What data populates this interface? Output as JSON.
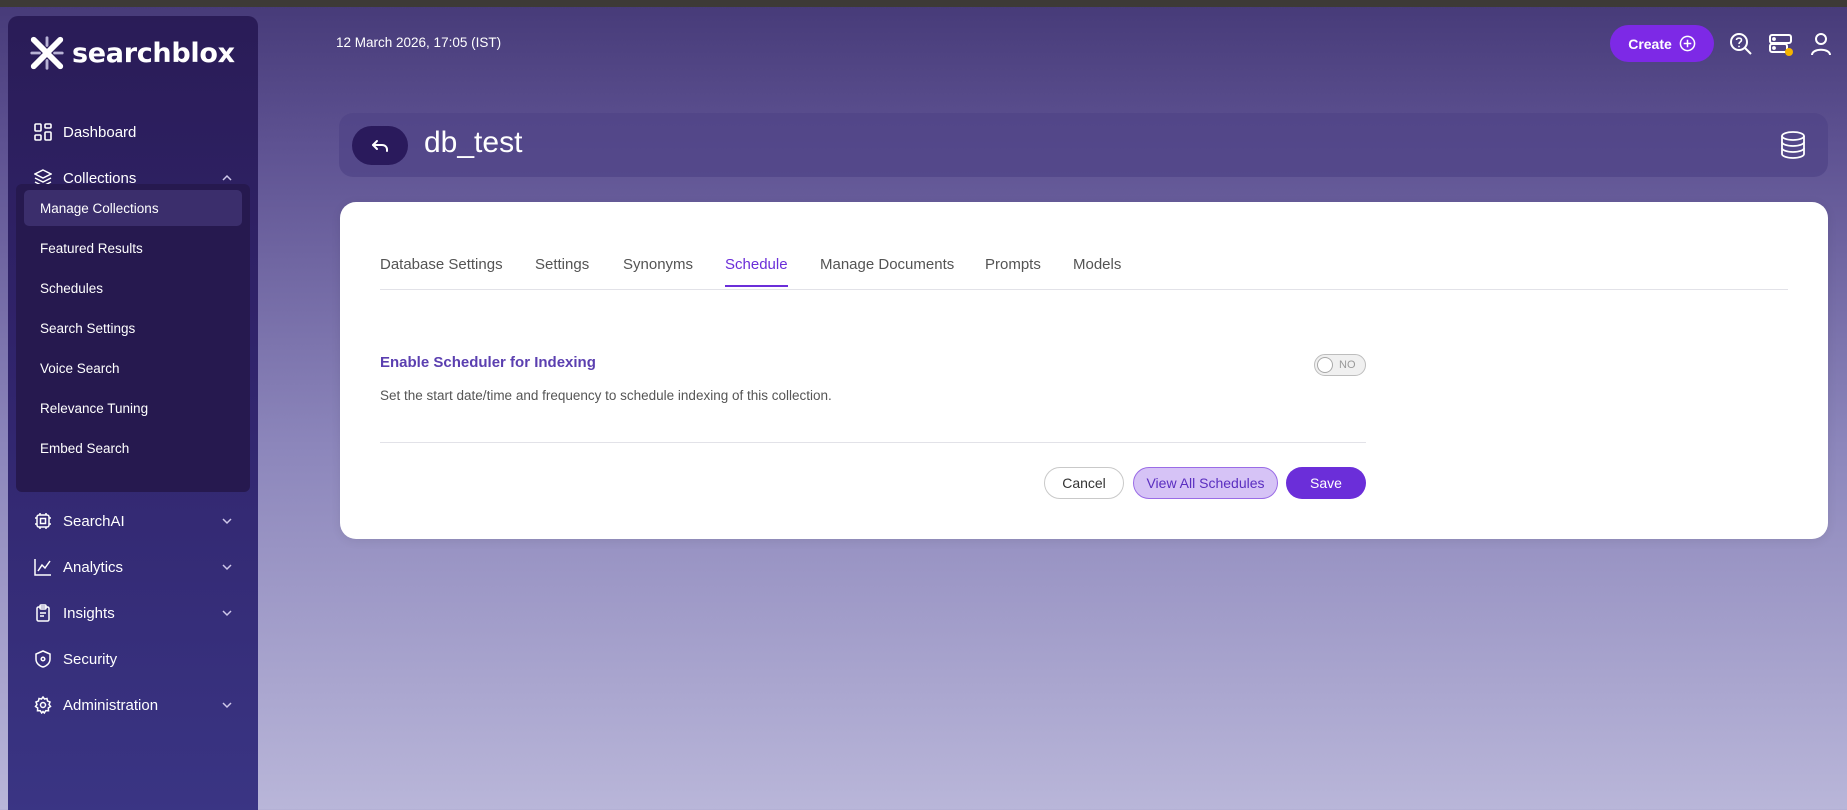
{
  "sidebar": {
    "logo_text": "searchblox",
    "items": [
      {
        "label": "Dashboard",
        "icon": "dashboard-icon"
      },
      {
        "label": "Collections",
        "icon": "layers-icon",
        "expanded": true
      },
      {
        "label": "SearchAI",
        "icon": "chip-icon"
      },
      {
        "label": "Analytics",
        "icon": "analytics-icon"
      },
      {
        "label": "Insights",
        "icon": "clipboard-icon"
      },
      {
        "label": "Security",
        "icon": "shield-icon"
      },
      {
        "label": "Administration",
        "icon": "gear-icon"
      }
    ],
    "subitems": [
      {
        "label": "Manage Collections",
        "active": true
      },
      {
        "label": "Featured Results"
      },
      {
        "label": "Schedules"
      },
      {
        "label": "Search Settings"
      },
      {
        "label": "Voice Search"
      },
      {
        "label": "Relevance Tuning"
      },
      {
        "label": "Embed Search"
      }
    ]
  },
  "header": {
    "datetime": "12 March 2026, 17:05 (IST)",
    "create_label": "Create",
    "icons": [
      "help-search-icon",
      "server-status-icon",
      "user-icon"
    ]
  },
  "page": {
    "title": "db_test",
    "title_icon": "database-icon"
  },
  "tabs": [
    {
      "label": "Database Settings"
    },
    {
      "label": "Settings"
    },
    {
      "label": "Synonyms"
    },
    {
      "label": "Schedule",
      "active": true
    },
    {
      "label": "Manage Documents"
    },
    {
      "label": "Prompts"
    },
    {
      "label": "Models"
    }
  ],
  "schedule": {
    "title": "Enable Scheduler for Indexing",
    "description": "Set the start date/time and frequency to schedule indexing of this collection.",
    "toggle_label": "NO",
    "toggle_on": false
  },
  "actions": {
    "cancel": "Cancel",
    "view_all": "View All Schedules",
    "save": "Save"
  },
  "colors": {
    "accent": "#6b2ed9",
    "create_button": "#7d29e6",
    "sidebar_bg": "#2a1c57",
    "status_dot": "#f5b400"
  }
}
